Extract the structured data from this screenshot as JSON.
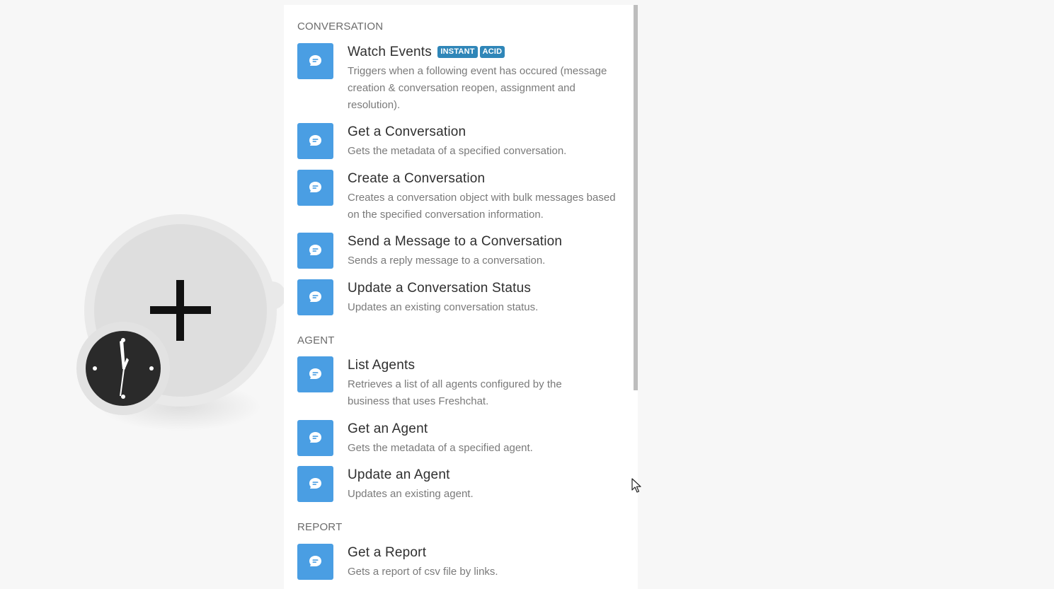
{
  "module": {
    "add_icon": "plus-icon",
    "trigger_icon": "clock-icon"
  },
  "colors": {
    "app_icon_bg": "#4a9ee3",
    "badge_bg": "#2f86b8",
    "panel_bg": "#ffffff",
    "canvas_bg": "#f7f7f7"
  },
  "menu": {
    "sections": [
      {
        "title": "CONVERSATION",
        "items": [
          {
            "title": "Watch Events",
            "badges": [
              "INSTANT",
              "ACID"
            ],
            "desc": "Triggers when a following event has occured (message creation & conversation reopen, assignment and resolution).",
            "icon": "freshchat-icon"
          },
          {
            "title": "Get a Conversation",
            "desc": "Gets the metadata of a specified conversation.",
            "icon": "freshchat-icon"
          },
          {
            "title": "Create a Conversation",
            "desc": "Creates a conversation object with bulk messages based on the specified conversation information.",
            "icon": "freshchat-icon"
          },
          {
            "title": "Send a Message to a Conversation",
            "desc": "Sends a reply message to a conversation.",
            "icon": "freshchat-icon"
          },
          {
            "title": "Update a Conversation Status",
            "desc": "Updates an existing conversation status.",
            "icon": "freshchat-icon"
          }
        ]
      },
      {
        "title": "AGENT",
        "items": [
          {
            "title": "List Agents",
            "desc": "Retrieves a list of all agents configured by the business that uses Freshchat.",
            "icon": "freshchat-icon"
          },
          {
            "title": "Get an Agent",
            "desc": "Gets the metadata of a specified agent.",
            "icon": "freshchat-icon"
          },
          {
            "title": "Update an Agent",
            "desc": "Updates an existing agent.",
            "icon": "freshchat-icon"
          }
        ]
      },
      {
        "title": "REPORT",
        "items": [
          {
            "title": "Get a Report",
            "desc": "Gets a report of csv file by links.",
            "icon": "freshchat-icon"
          }
        ]
      }
    ]
  }
}
